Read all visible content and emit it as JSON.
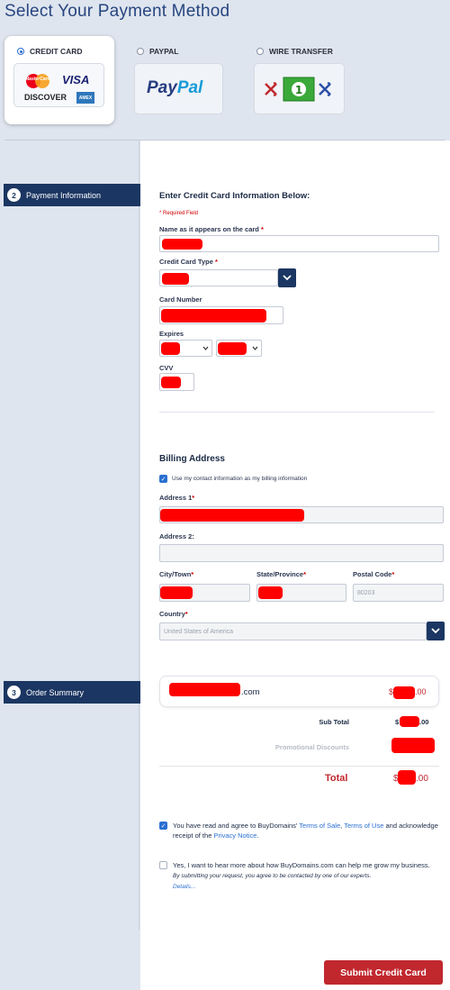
{
  "page_title": "Select Your Payment Method",
  "payment_methods": {
    "credit_card": {
      "label": "CREDIT CARD",
      "logos": [
        "MasterCard",
        "VISA",
        "DISCOVER",
        "AMEX"
      ]
    },
    "paypal": {
      "label": "PAYPAL",
      "logo_text": "PayPal"
    },
    "wire_transfer": {
      "label": "WIRE TRANSFER"
    },
    "selected": "credit_card"
  },
  "steps": {
    "payment_info": {
      "number": "2",
      "label": "Payment Information"
    },
    "order_summary": {
      "number": "3",
      "label": "Order Summary"
    }
  },
  "card_form": {
    "heading": "Enter Credit Card Information Below:",
    "required_note": "* Required Field",
    "name_label": "Name as it appears on the card",
    "type_label": "Credit Card Type",
    "number_label": "Card Number",
    "expires_label": "Expires",
    "cvv_label": "CVV",
    "required_mark": "*"
  },
  "billing": {
    "heading": "Billing Address",
    "use_contact_label": "Use my contact information as my billing information",
    "use_contact_checked": true,
    "address1_label": "Address 1",
    "address2_label": "Address 2:",
    "city_label": "City/Town",
    "state_label": "State/Province",
    "postal_label": "Postal Code",
    "postal_value": "80203",
    "country_label": "Country",
    "country_value": "United States of America"
  },
  "order_summary": {
    "domain_suffix": ".com",
    "price_prefix": "$",
    "price_suffix": ".00",
    "subtotal_label": "Sub Total",
    "subtotal_prefix": "$",
    "subtotal_suffix": ".00",
    "promo_label": "Promotional Discounts",
    "total_label": "Total",
    "total_prefix": "$",
    "total_suffix": ".00"
  },
  "agreements": {
    "terms_text_1": "You have read and agree to BuyDomains'",
    "terms_link_1": "Terms of Sale",
    "terms_sep": ",",
    "terms_link_2": "Terms of Use",
    "terms_text_2": "and acknowledge receipt of the",
    "privacy_link": "Privacy Notice",
    "terms_end": ".",
    "terms_checked": true,
    "marketing_text": "Yes, I want to hear more about how BuyDomains.com can help me grow my business.",
    "marketing_note": "By submitting your request, you agree to be contacted by one of our experts.",
    "details_link": "Details...",
    "marketing_checked": false
  },
  "submit_label": "Submit Credit Card",
  "colors": {
    "primary": "#1b3662",
    "accent_red": "#c0282e",
    "link_blue": "#2a6fd1",
    "redaction": "#ff0000"
  }
}
